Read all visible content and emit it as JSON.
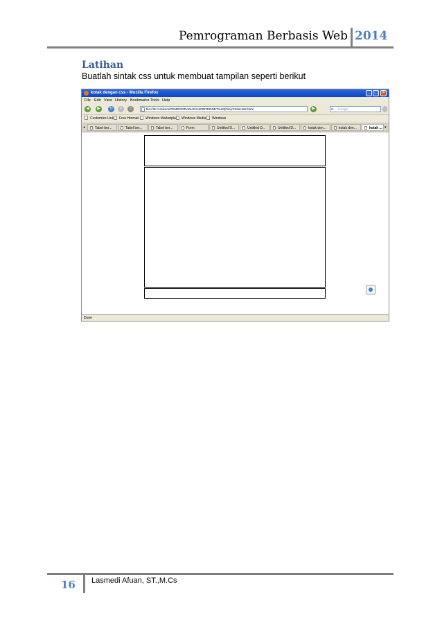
{
  "header": {
    "title": "Pemrograman Berbasis Web",
    "year": "2014"
  },
  "section": {
    "heading": "Latihan",
    "instruction": "Buatlah sintak css untuk membuat tampilan seperti berikut"
  },
  "browser": {
    "window_title": "kotak dengan css - Mozilla Firefox",
    "menu": [
      "File",
      "Edit",
      "View",
      "History",
      "Bookmarks",
      "Tools",
      "Help"
    ],
    "url": "file:///E:/Amikom/PEMROGRAMAN%20INTERNET%20(File)/CSS/css2.html",
    "search_placeholder": "Google",
    "bookmarks": [
      "Customize Links",
      "Free Hotmail",
      "Windows Marketplace",
      "Windows Media",
      "Windows"
    ],
    "tabs": [
      "Tabel ber...",
      "Tabel ber...",
      "Tabel ber...",
      "Form",
      "Untitled D...",
      "Untitled D...",
      "Untitled D...",
      "kotak den...",
      "kotak den...",
      "kotak ..."
    ],
    "status": "Done"
  },
  "footer": {
    "page_number": "16",
    "author": "Lasmedi Afuan, ST.,M.Cs"
  }
}
